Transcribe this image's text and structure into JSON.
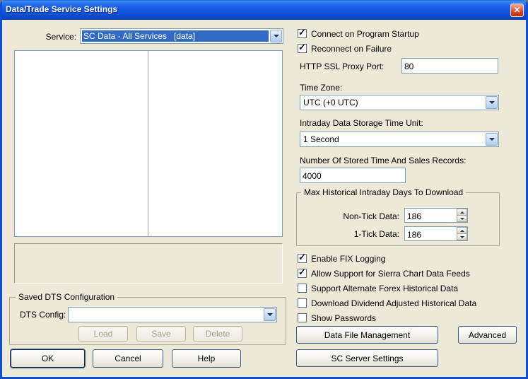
{
  "window": {
    "title": "Data/Trade Service Settings",
    "close_glyph": "✕"
  },
  "left": {
    "service_label": "Service:",
    "service_value": "SC Data - All Services   [data]",
    "dts_group_label": "Saved DTS Configuration",
    "dts_config_label": "DTS Config:",
    "dts_config_value": "",
    "load_label": "Load",
    "save_label": "Save",
    "delete_label": "Delete",
    "ok_label": "OK",
    "cancel_label": "Cancel",
    "help_label": "Help"
  },
  "right": {
    "connect_startup": {
      "label": "Connect on Program Startup",
      "mark": "✓"
    },
    "reconnect_failure": {
      "label": "Reconnect on Failure",
      "mark": "✓"
    },
    "proxy_label": "HTTP SSL Proxy Port:",
    "proxy_value": "80",
    "timezone_label": "Time Zone:",
    "timezone_value": "UTC (+0 UTC)",
    "storage_unit_label": "Intraday Data Storage Time Unit:",
    "storage_unit_value": "1 Second",
    "records_label": "Number Of Stored Time And Sales Records:",
    "records_value": "4000",
    "max_days_group_label": "Max Historical Intraday Days To Download",
    "non_tick_label": "Non-Tick Data:",
    "non_tick_value": "186",
    "one_tick_label": "1-Tick Data:",
    "one_tick_value": "186",
    "fix_logging": {
      "label": "Enable FIX Logging",
      "mark": "✓"
    },
    "sierra_feeds": {
      "label": "Allow Support for Sierra Chart Data Feeds",
      "mark": "✓"
    },
    "alt_forex": {
      "label": "Support Alternate Forex Historical Data",
      "mark": ""
    },
    "dividend_adjusted": {
      "label": "Download Dividend Adjusted Historical Data",
      "mark": ""
    },
    "show_passwords": {
      "label": "Show Passwords",
      "mark": ""
    },
    "data_file_mgmt_label": "Data File Management",
    "advanced_label": "Advanced",
    "sc_server_label": "SC Server Settings"
  }
}
